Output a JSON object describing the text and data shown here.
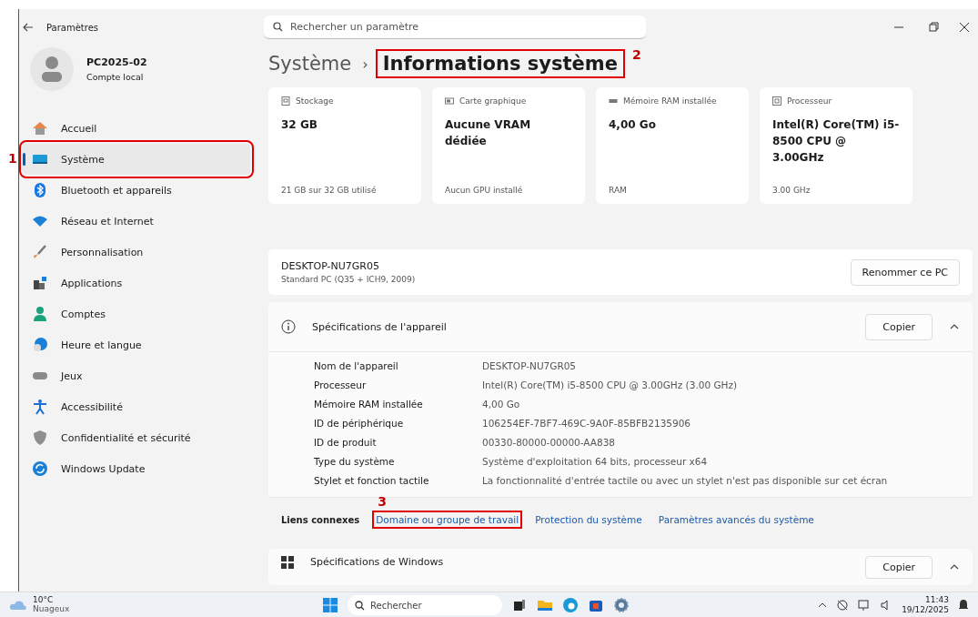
{
  "window": {
    "title": "Paramètres"
  },
  "search": {
    "placeholder": "Rechercher un paramètre"
  },
  "profile": {
    "name": "PC2025-02",
    "account": "Compte local"
  },
  "sidebar": {
    "items": [
      {
        "label": "Accueil",
        "kind": "home",
        "selected": false
      },
      {
        "label": "Système",
        "kind": "system",
        "selected": true,
        "annotation": "1"
      },
      {
        "label": "Bluetooth et appareils",
        "kind": "bluetooth",
        "selected": false
      },
      {
        "label": "Réseau et Internet",
        "kind": "wifi",
        "selected": false
      },
      {
        "label": "Personnalisation",
        "kind": "brush",
        "selected": false
      },
      {
        "label": "Applications",
        "kind": "apps",
        "selected": false
      },
      {
        "label": "Comptes",
        "kind": "person",
        "selected": false
      },
      {
        "label": "Heure et langue",
        "kind": "clock",
        "selected": false
      },
      {
        "label": "Jeux",
        "kind": "gamepad",
        "selected": false
      },
      {
        "label": "Accessibilité",
        "kind": "accessibility",
        "selected": false
      },
      {
        "label": "Confidentialité et sécurité",
        "kind": "shield",
        "selected": false
      },
      {
        "label": "Windows Update",
        "kind": "update",
        "selected": false
      }
    ]
  },
  "breadcrumb": {
    "parent": "Système",
    "separator": "›",
    "current": "Informations système",
    "annotation": "2"
  },
  "cards": [
    {
      "kind": "storage",
      "label": "Stockage",
      "value": "32 GB",
      "detail": "21 GB sur 32 GB utilisé"
    },
    {
      "kind": "gpu",
      "label": "Carte graphique",
      "value": "Aucune VRAM dédiée",
      "detail": "Aucun GPU installé"
    },
    {
      "kind": "ram",
      "label": "Mémoire RAM installée",
      "value": "4,00 Go",
      "detail": "RAM"
    },
    {
      "kind": "cpu",
      "label": "Processeur",
      "value": "Intel(R) Core(TM) i5-8500 CPU @ 3.00GHz",
      "detail": "3.00 GHz"
    }
  ],
  "device": {
    "name": "DESKTOP-NU7GR05",
    "model": "Standard PC (Q35 + ICH9, 2009)",
    "button": "Renommer ce PC"
  },
  "device_specs": {
    "title": "Spécifications de l'appareil",
    "button": "Copier",
    "expanded": true,
    "rows": [
      {
        "label": "Nom de l'appareil",
        "value": "DESKTOP-NU7GR05"
      },
      {
        "label": "Processeur",
        "value": "Intel(R) Core(TM) i5-8500 CPU @ 3.00GHz (3.00 GHz)"
      },
      {
        "label": "Mémoire RAM installée",
        "value": "4,00 Go"
      },
      {
        "label": "ID de périphérique",
        "value": "106254EF-7BF7-469C-9A0F-85BFB2135906"
      },
      {
        "label": "ID de produit",
        "value": "00330-80000-00000-AA838"
      },
      {
        "label": "Type du système",
        "value": "Système d'exploitation 64 bits, processeur x64"
      },
      {
        "label": "Stylet et fonction tactile",
        "value": "La fonctionnalité d'entrée tactile ou avec un stylet n'est pas disponible sur cet écran"
      }
    ],
    "related_label": "Liens connexes",
    "links": [
      {
        "label": "Domaine ou groupe de travail",
        "annotation": "3"
      },
      {
        "label": "Protection du système"
      },
      {
        "label": "Paramètres avancés du système"
      }
    ]
  },
  "windows_specs": {
    "title": "Spécifications de Windows",
    "button": "Copier"
  },
  "taskbar": {
    "temperature": "10°C",
    "weather": "Nuageux",
    "search": "Rechercher",
    "time": "11:43",
    "date": "19/12/2025"
  }
}
